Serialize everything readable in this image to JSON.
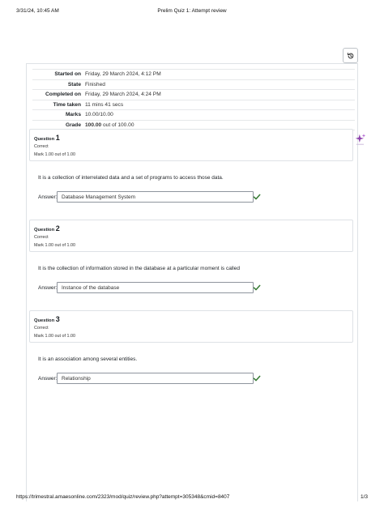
{
  "print_header": {
    "datetime": "3/31/24, 10:45 AM",
    "title": "Prelim Quiz 1: Attempt review"
  },
  "print_footer": {
    "url": "https://trimestral.amaesonline.com/2323/mod/quiz/review.php?attempt=305348&cmid=8407",
    "page": "1/3"
  },
  "summary": [
    {
      "label": "Started on",
      "value": "Friday, 29 March 2024, 4:12 PM"
    },
    {
      "label": "State",
      "value": "Finished"
    },
    {
      "label": "Completed on",
      "value": "Friday, 29 March 2024, 4:24 PM"
    },
    {
      "label": "Time taken",
      "value": "11 mins 41 secs"
    },
    {
      "label": "Marks",
      "value": "10.00/10.00"
    },
    {
      "label": "Grade",
      "value_bold": "100.00",
      "value_rest": " out of 100.00"
    }
  ],
  "questions": [
    {
      "prefix": "Question ",
      "number": "1",
      "state": "Correct",
      "grade": "Mark 1.00 out of 1.00",
      "text": "It is a collection of interrelated data and a set of programs to access those data.",
      "answer_label": "Answer:",
      "answer": "Database Management System"
    },
    {
      "prefix": "Question ",
      "number": "2",
      "state": "Correct",
      "grade": "Mark 1.00 out of 1.00",
      "text": "It is the collection of information stored in the database at a particular moment is called",
      "answer_label": "Answer:",
      "answer": "Instance of the database"
    },
    {
      "prefix": "Question ",
      "number": "3",
      "state": "Correct",
      "grade": "Mark 1.00 out of 1.00",
      "text": "It is an association among several entities.",
      "answer_label": "Answer:",
      "answer": "Relationship"
    }
  ],
  "colors": {
    "correct": "#357a32",
    "ai_accent": "#8e44ad",
    "border": "#dee2e6"
  },
  "icons": {
    "history": "history-icon",
    "ai": "sparkle-icon",
    "check": "check-icon"
  }
}
